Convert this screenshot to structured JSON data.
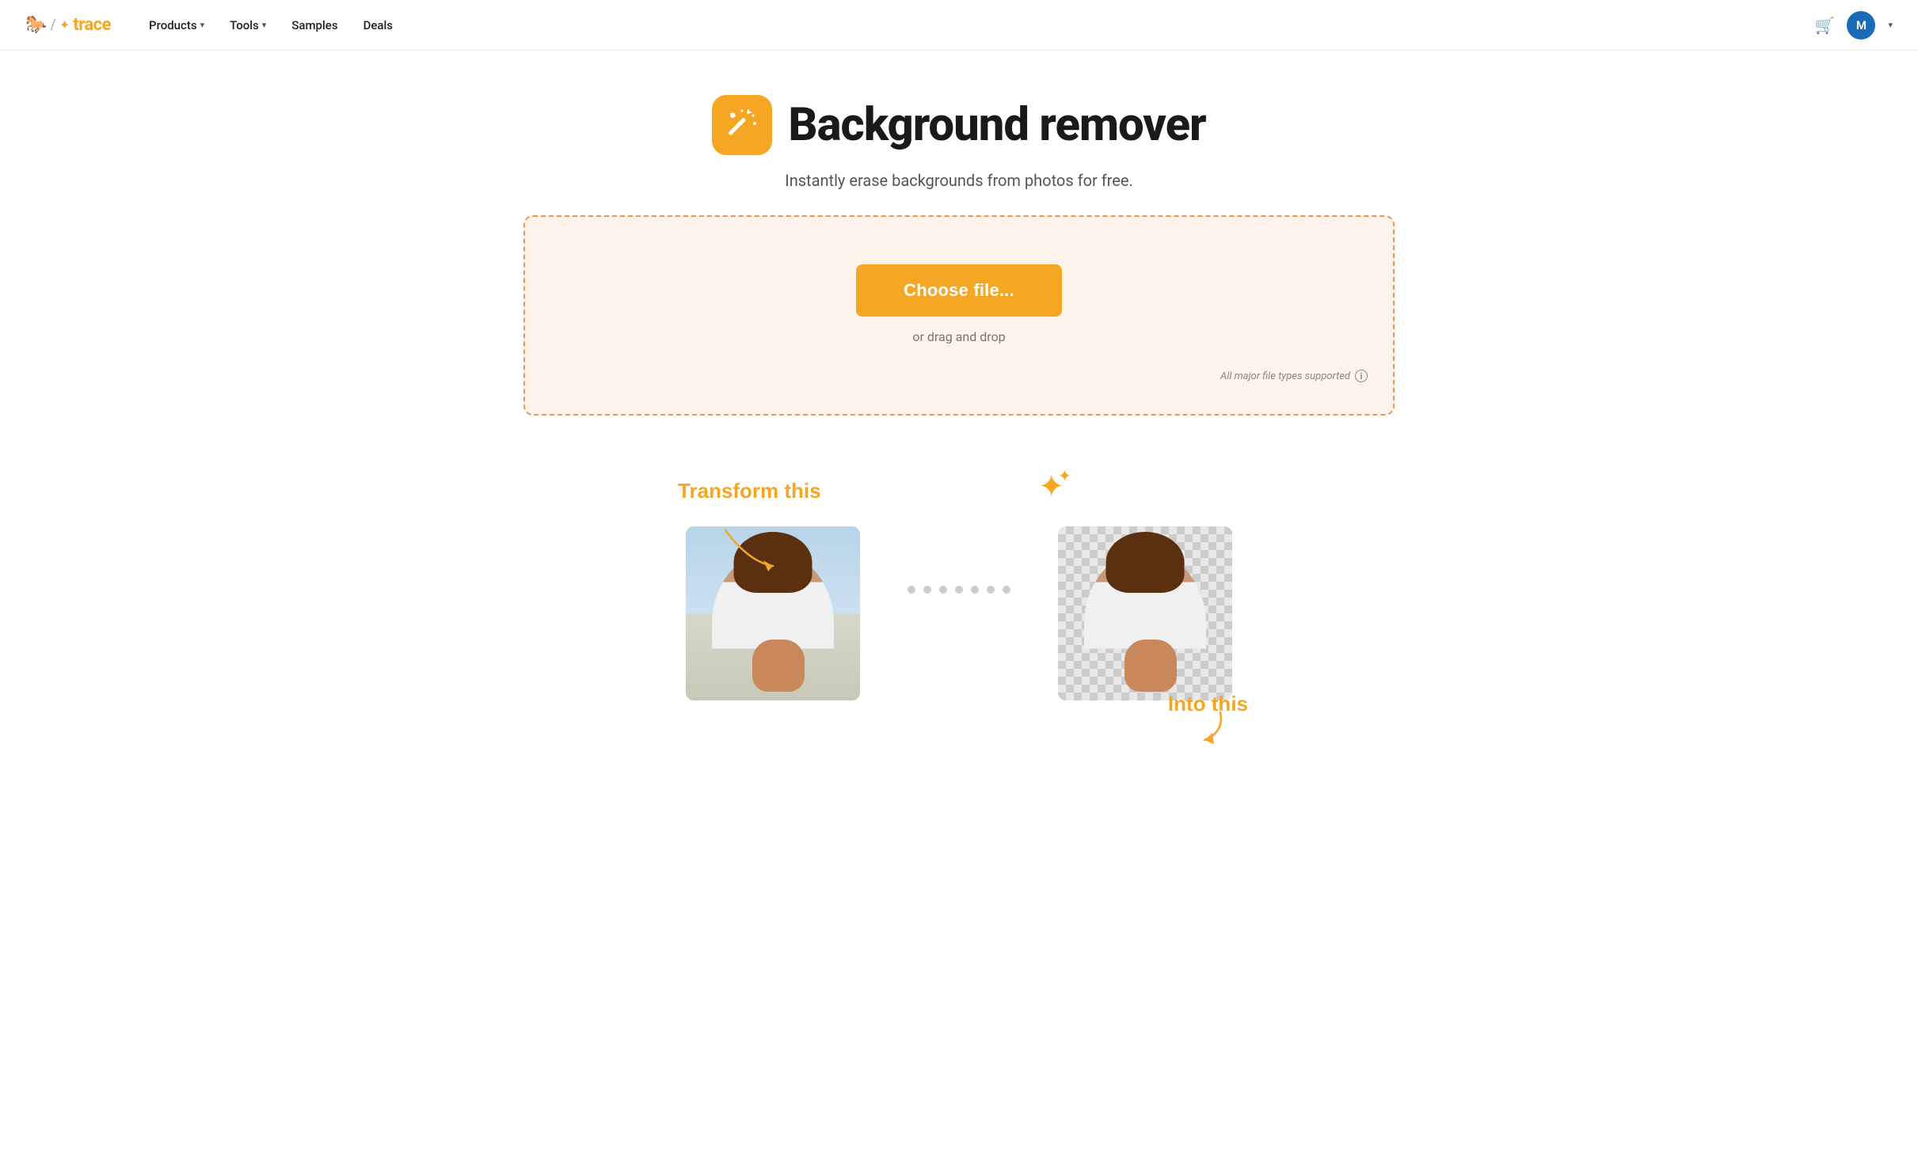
{
  "brand": {
    "logo_horse": "🐎",
    "logo_text": "trace",
    "logo_slash": "/",
    "logo_star": "✦"
  },
  "navbar": {
    "items": [
      {
        "label": "Products",
        "has_caret": true
      },
      {
        "label": "Tools",
        "has_caret": true
      },
      {
        "label": "Samples",
        "has_caret": false
      },
      {
        "label": "Deals",
        "has_caret": false
      }
    ],
    "cart_icon": "🛒",
    "avatar_letter": "M"
  },
  "hero": {
    "title": "Background remover",
    "subtitle": "Instantly erase backgrounds from photos for free."
  },
  "upload": {
    "choose_btn": "Choose file...",
    "drag_drop": "or drag and drop",
    "file_types": "All major file types supported"
  },
  "demo": {
    "transform_label": "Transform this",
    "into_label": "Into this",
    "dots_count": 7,
    "sparkles": "✦"
  }
}
